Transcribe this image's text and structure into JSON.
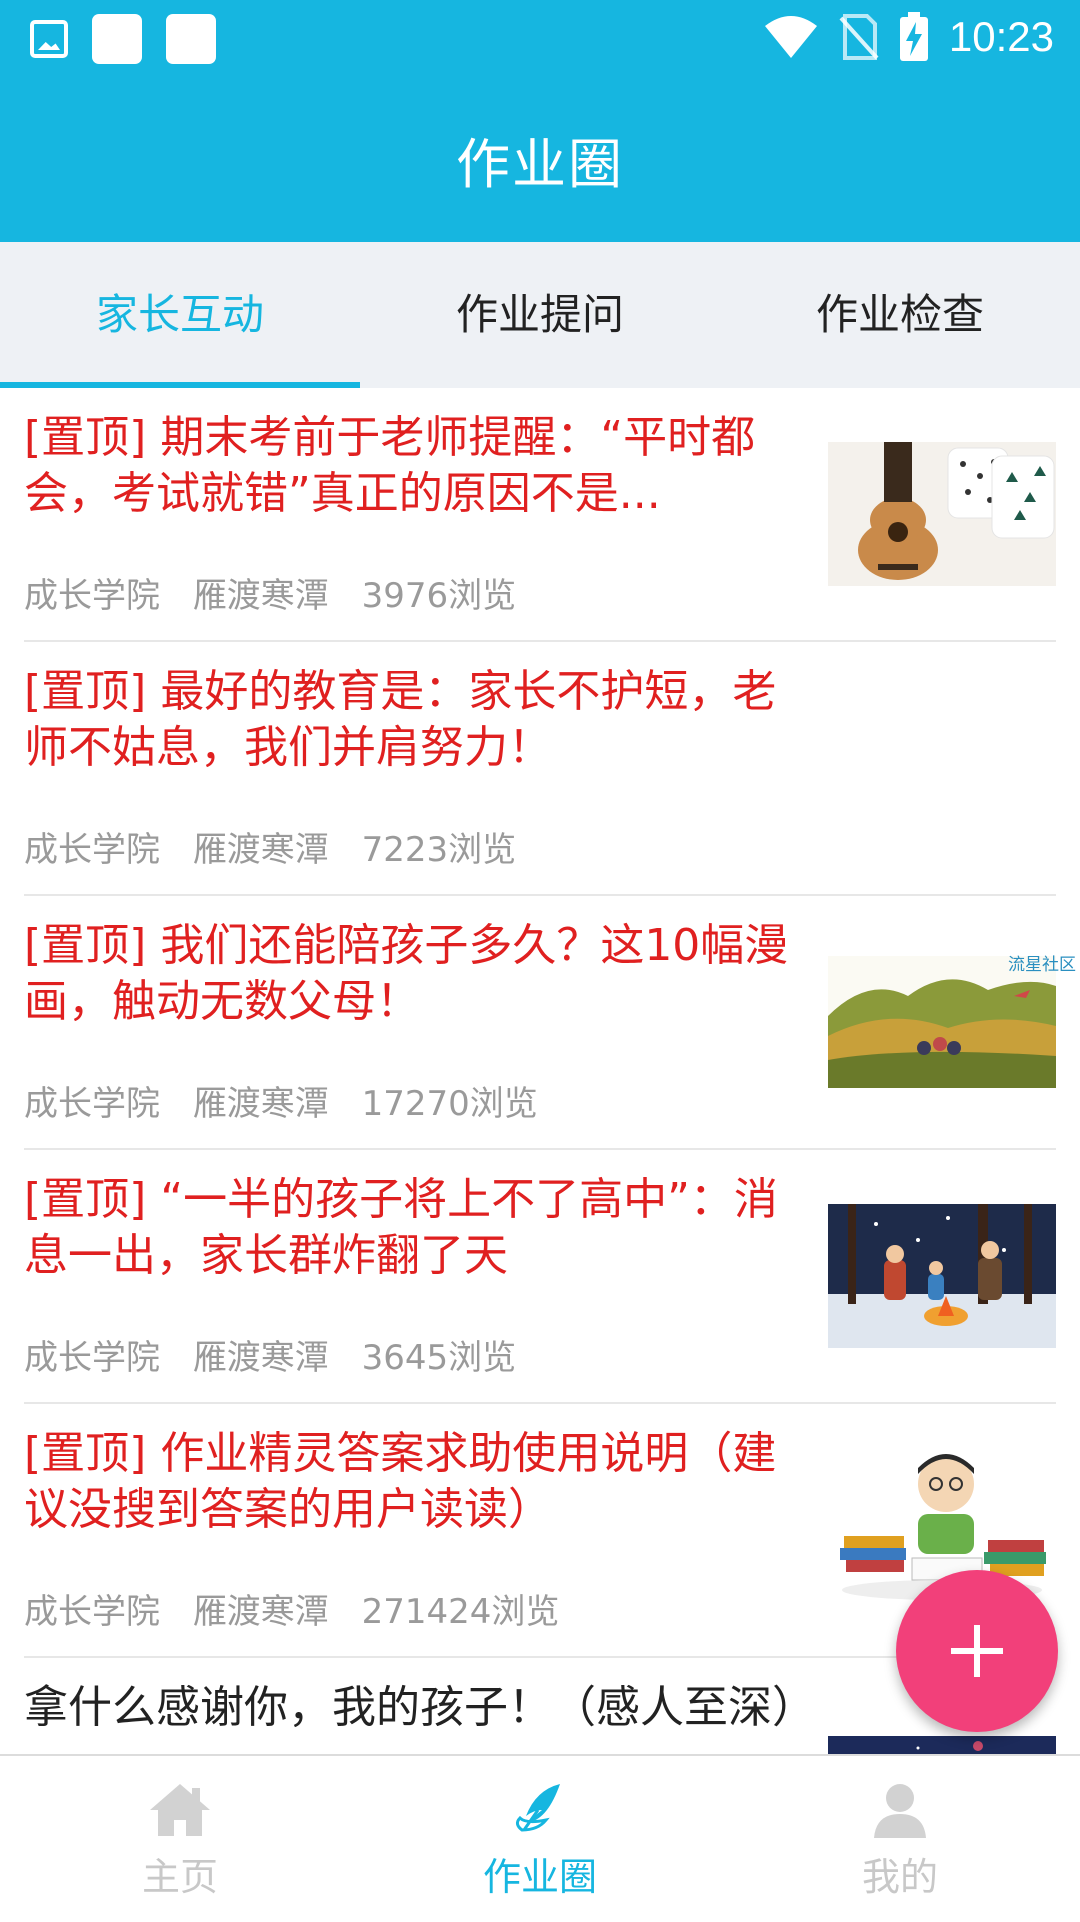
{
  "status_bar": {
    "time": "10:23"
  },
  "header": {
    "title": "作业圈"
  },
  "tabs": [
    {
      "label": "家长互动",
      "active": true
    },
    {
      "label": "作业提问",
      "active": false
    },
    {
      "label": "作业检查",
      "active": false
    }
  ],
  "feed": {
    "items": [
      {
        "title": "[置顶] 期末考前于老师提醒：“平时都会，考试就错”真正的原因不是...",
        "category": "成长学院",
        "author": "雁渡寒潭",
        "views": "3976浏览",
        "image": "ukulele-on-bed"
      },
      {
        "title": "[置顶] 最好的教育是：家长不护短，老师不姑息，我们并肩努力！",
        "category": "成长学院",
        "author": "雁渡寒潭",
        "views": "7223浏览"
      },
      {
        "title": "[置顶] 我们还能陪孩子多久？这10幅漫画，触动无数父母！",
        "category": "成长学院",
        "author": "雁渡寒潭",
        "views": "17270浏览",
        "image": "family-on-hill",
        "watermark": "流星社区"
      },
      {
        "title": "[置顶] “一半的孩子将上不了高中”：消息一出，家长群炸翻了天",
        "category": "成长学院",
        "author": "雁渡寒潭",
        "views": "3645浏览",
        "image": "campfire-night"
      },
      {
        "title": "[置顶] 作业精灵答案求助使用说明（建议没搜到答案的用户读读）",
        "category": "成长学院",
        "author": "雁渡寒潭",
        "views": "271424浏览",
        "image": "child-with-books"
      },
      {
        "title": "拿什么感谢你，我的孩子！（感人至深）",
        "image": "night-sky"
      }
    ]
  },
  "fab": {
    "icon": "plus-icon"
  },
  "bottom_nav": [
    {
      "label": "主页",
      "icon": "home-icon",
      "active": false
    },
    {
      "label": "作业圈",
      "icon": "feather-icon",
      "active": true
    },
    {
      "label": "我的",
      "icon": "person-icon",
      "active": false
    }
  ],
  "colors": {
    "accent": "#16b6e0",
    "pinned_title": "#e02020",
    "fab": "#f2407a",
    "meta": "#9a9a9a"
  }
}
